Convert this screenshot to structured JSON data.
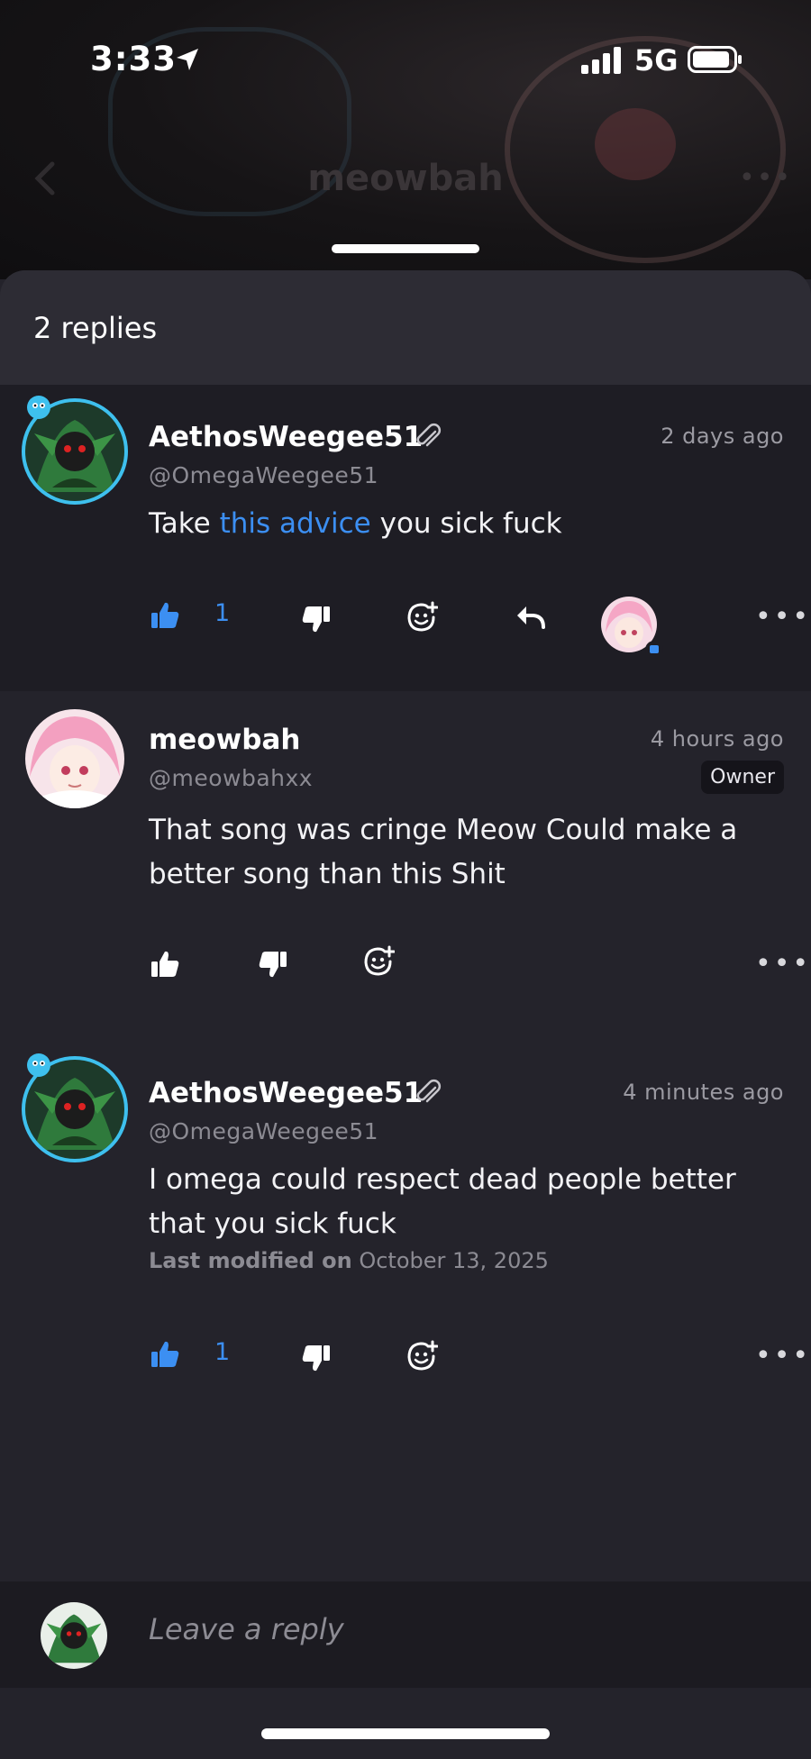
{
  "status_bar": {
    "time": "3:33",
    "network": "5G"
  },
  "nav": {
    "title": "meowbah"
  },
  "sheet": {
    "replies_count": "2 replies"
  },
  "comments": [
    {
      "user": "AethosWeegee51",
      "handle": "@OmegaWeegee51",
      "time": "2 days ago",
      "body_pre": "Take ",
      "body_link": "this advice",
      "body_post": " you sick fuck",
      "likes": "1",
      "liked": true
    },
    {
      "user": "meowbah",
      "handle": "@meowbahxx",
      "time": "4 hours ago",
      "badge": "Owner",
      "body": "That song was cringe Meow Could make a better song than this Shit",
      "liked": false
    },
    {
      "user": "AethosWeegee51",
      "handle": "@OmegaWeegee51",
      "time": "4 minutes ago",
      "body": "I omega could respect dead people better that you sick fuck",
      "modified_label": "Last modified on",
      "modified_date": "October 13, 2025",
      "likes": "1",
      "liked": true
    }
  ],
  "reply_bar": {
    "placeholder": "Leave a reply"
  },
  "colors": {
    "accent": "#3c8ff2",
    "ring": "#3ec0ee",
    "background": "#24232b"
  }
}
